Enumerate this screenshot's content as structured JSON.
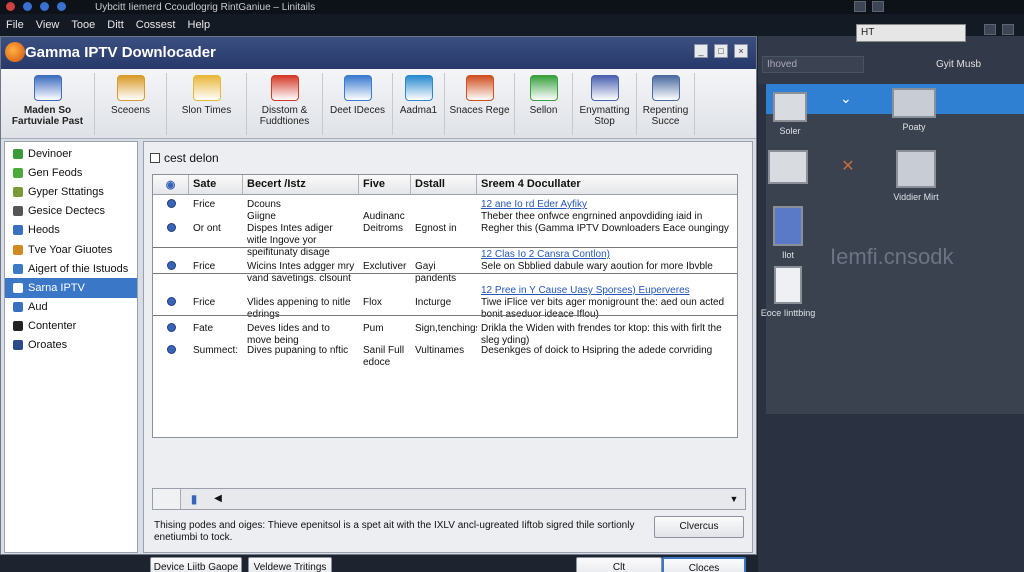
{
  "outer": {
    "title": "Uybcitt Iiemerd Ccoudlogrig RintGaniue – Linitails",
    "menu": [
      "File",
      "View",
      "Tooe",
      "Ditt",
      "Cossest",
      "Help"
    ],
    "right_select": "HT",
    "right_input": "Ihoved",
    "right_link": "Gyit Musb",
    "right_items": [
      "Soler",
      "Poaty",
      "Viddier Mirt",
      "Ilot",
      "Eoce Iinttbing"
    ],
    "watermark": "Iemfi.cnsodk"
  },
  "window": {
    "title": "Gamma IPTV Downlocader"
  },
  "toolbar": {
    "buttons": [
      {
        "label": "Maden So Fartuviale Past",
        "icon": "pen-icon",
        "color": "#3d6cc0"
      },
      {
        "label": "Sceoens",
        "icon": "screens-icon",
        "color": "#d99b2a"
      },
      {
        "label": "Slon Times",
        "icon": "folder-icon",
        "color": "#e8b83a"
      },
      {
        "label": "Disstom & Fuddtiones",
        "icon": "chrome-icon",
        "color": "#d43a2a"
      },
      {
        "label": "Deet IDeces",
        "icon": "devices-icon",
        "color": "#3a7ad0"
      },
      {
        "label": "Aadma1",
        "icon": "media-icon",
        "color": "#2a8ad0"
      },
      {
        "label": "Snaces Rege",
        "icon": "badge-icon",
        "color": "#d05020"
      },
      {
        "label": "Sellon",
        "icon": "settings-icon",
        "color": "#3aa040"
      },
      {
        "label": "Enymatting Stop",
        "icon": "image-icon",
        "color": "#4a60b0"
      },
      {
        "label": "Repenting Succe",
        "icon": "user-icon",
        "color": "#4a6aa0"
      }
    ]
  },
  "sidebar": {
    "items": [
      {
        "label": "Devinoer",
        "color": "#3a9a3a",
        "selected": false
      },
      {
        "label": "Gen Feods",
        "color": "#4aaa3a",
        "selected": false
      },
      {
        "label": "Gyper Sttatings",
        "color": "#7a9a3a",
        "selected": false
      },
      {
        "label": "Gesice Dectecs",
        "color": "#555555",
        "selected": false
      },
      {
        "label": "Heods",
        "color": "#3a70c0",
        "selected": false
      },
      {
        "label": "Tve Yoar Giuotes",
        "color": "#d08a20",
        "selected": false
      },
      {
        "label": "Aigert of thie Istuods",
        "color": "#3a7ac0",
        "selected": false
      },
      {
        "label": "Sarna IPTV",
        "color": "#ffffff",
        "selected": true
      },
      {
        "label": "Aud",
        "color": "#3a70c0",
        "selected": false
      },
      {
        "label": "Contenter",
        "color": "#222222",
        "selected": false
      },
      {
        "label": "Oroates",
        "color": "#2a4a8a",
        "selected": false
      }
    ]
  },
  "content": {
    "heading": "cest delon",
    "columns": [
      "Sate",
      "Becert /Istz",
      "Five",
      "Dstall",
      "Sreem 4 Docullater"
    ],
    "rows": [
      {
        "c1": "Frice",
        "c2": "Dcouns",
        "c3": "",
        "c4": "",
        "c5": "12 ane Io rd Eder Ayfiky",
        "link": true
      },
      {
        "c1": "",
        "c2": "Giigne",
        "c3": "Audinanc",
        "c4": "",
        "c5": "Theber thee onfwce engrnined anpovdiding iaid in",
        "link": false
      },
      {
        "c1": "Or ont",
        "c2": "Dispes Intes adiger witle Ingove yor speifitunaty disage",
        "c3": "Deitroms",
        "c4": "Egnost in",
        "c5": "Regher this (Gamma IPTV Downloaders Eace oungingy",
        "link": false
      },
      {
        "c1": "",
        "c2": "",
        "c3": "",
        "c4": "",
        "c5": "12 Clas Io 2 Cansra Contlon)",
        "link": true
      },
      {
        "c1": "Frice",
        "c2": "Wicins Intes adgger mry vand savetings. clsount",
        "c3": "Exclutiver",
        "c4": "Gayi pandents",
        "c5": "Sele on Sbblied dabule wary aoution for more Ibvble",
        "link": false
      },
      {
        "c1": "",
        "c2": "",
        "c3": "",
        "c4": "",
        "c5": "12 Pree in Y Cause Uasy Sporses) Euperveres",
        "link": true
      },
      {
        "c1": "Frice",
        "c2": "Vlides appening to nitle edrings",
        "c3": "Flox",
        "c4": "Incturge",
        "c5": "Tiwe iFlice ver bits ager monigrount the: aed oun acted bonit aseduor ideace Iflou)",
        "link": false
      },
      {
        "c1": "Fate",
        "c2": "Deves Iides and to move being",
        "c3": "Pum",
        "c4": "Sign,tenchings",
        "c5": "Drikla the Widen with frendes tor ktop: this with firlt the sleg yding)",
        "link": false
      },
      {
        "c1": "Summect:",
        "c2": "Dives pupaning to nftic",
        "c3": "Sanil Full edoce",
        "c4": "Vultinames",
        "c5": "Desenkges of doick to Hsipring the adede corvriding",
        "link": false
      }
    ],
    "status_message": "Thising podes and oiges: Thieve epenitsol is a spet ait with the IXLV ancl-ugreated Iiftob sigred thile sortionly enetiumbi to tock.",
    "cleaver_button": "Clvercus",
    "device_button": "Device Liitb Gaope",
    "veldewe_button": "Veldewe Tritings",
    "ok_button": "Clt",
    "close_button": "Cloces"
  }
}
